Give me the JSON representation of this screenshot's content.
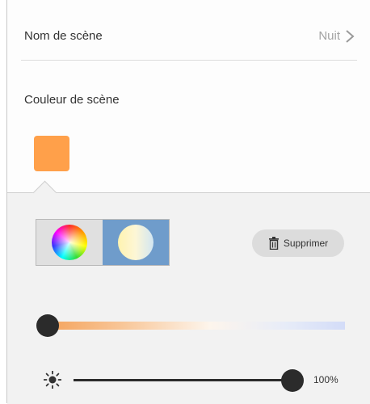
{
  "scene_name": {
    "label": "Nom de scène",
    "value": "Nuit",
    "chevron_icon": "chevron-right-icon"
  },
  "scene_color": {
    "label": "Couleur de scène",
    "swatch_color": "#ffa04a"
  },
  "color_panel": {
    "modes": [
      {
        "name": "color-wheel",
        "icon": "color-wheel-icon",
        "selected": false
      },
      {
        "name": "white-temperature",
        "icon": "white-temperature-icon",
        "selected": true
      }
    ],
    "selected_mode_color": "#6f9ccb",
    "delete_button": {
      "label": "Supprimer",
      "icon": "trash-icon"
    },
    "temperature_slider": {
      "value_percent": 0
    },
    "brightness": {
      "icon": "sun-icon",
      "value_percent": 100,
      "label": "100%"
    }
  }
}
